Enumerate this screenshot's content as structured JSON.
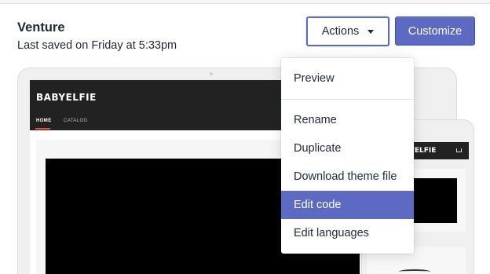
{
  "theme": {
    "name": "Venture",
    "last_saved": "Last saved on Friday at 5:33pm"
  },
  "buttons": {
    "actions": "Actions",
    "customize": "Customize"
  },
  "colors": {
    "primary": "#5c6ac4",
    "text": "#212b36",
    "site_header": "#222222",
    "nav_accent": "#e84c3d"
  },
  "preview": {
    "site_logo": "BABYELFIE",
    "mobile_logo": "BYELFIE",
    "nav": {
      "home": "HOME",
      "catalog": "CATALOG"
    }
  },
  "actions_menu": {
    "items": [
      {
        "label": "Preview"
      },
      {
        "label": "Rename"
      },
      {
        "label": "Duplicate"
      },
      {
        "label": "Download theme file"
      },
      {
        "label": "Edit code",
        "highlighted": true
      },
      {
        "label": "Edit languages"
      }
    ]
  }
}
